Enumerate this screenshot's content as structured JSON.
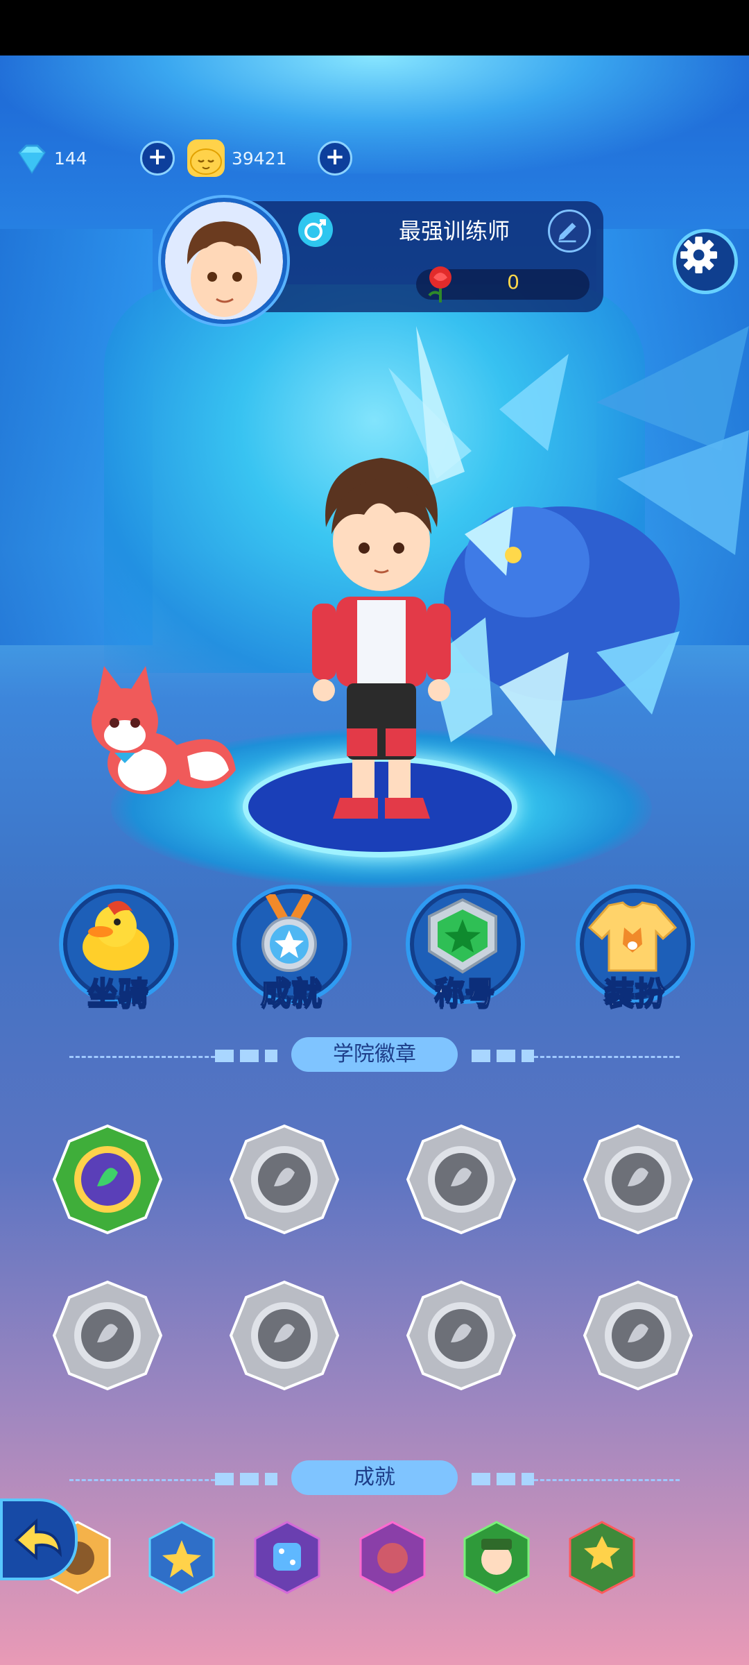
{
  "currency": {
    "gems": "144",
    "coins": "39421"
  },
  "profile": {
    "name": "最强训练师",
    "roses": "0"
  },
  "features": [
    {
      "label": "坐骑"
    },
    {
      "label": "成就"
    },
    {
      "label": "称号"
    },
    {
      "label": "装扮"
    }
  ],
  "sections": {
    "badges_title": "学院徽章",
    "achievements_title": "成就"
  },
  "badges": [
    {
      "icon": "leaf-badge-icon",
      "unlocked": true
    },
    {
      "icon": "swirl-badge-icon",
      "unlocked": false
    },
    {
      "icon": "flame-badge-icon",
      "unlocked": false
    },
    {
      "icon": "gear-badge-icon",
      "unlocked": false
    },
    {
      "icon": "snowflake-badge-icon",
      "unlocked": false
    },
    {
      "icon": "lightning-badge-icon",
      "unlocked": false
    },
    {
      "icon": "beast-badge-icon",
      "unlocked": false
    },
    {
      "icon": "wing-badge-icon",
      "unlocked": false
    }
  ],
  "colors": {
    "accent": "#7fc4ff",
    "gold": "#ffd84a",
    "badge_locked": "#b9bcc4",
    "badge_unlocked": "#3fae3a"
  }
}
